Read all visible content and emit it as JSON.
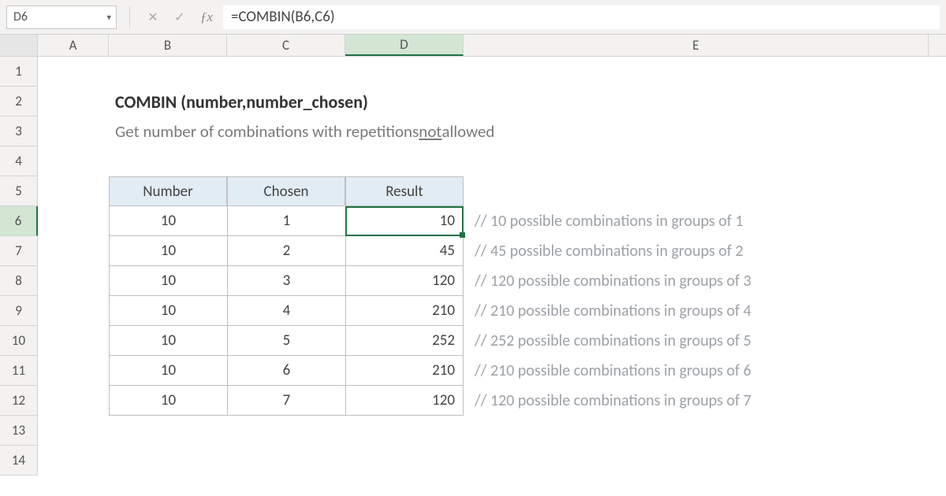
{
  "name_box": "D6",
  "formula": "=COMBIN(B6,C6)",
  "columns": [
    "A",
    "B",
    "C",
    "D",
    "E"
  ],
  "rows": [
    "1",
    "2",
    "3",
    "4",
    "5",
    "6",
    "7",
    "8",
    "9",
    "10",
    "11",
    "12",
    "13",
    "14"
  ],
  "title": "COMBIN (number,number_chosen)",
  "subtitle_pre": "Get number of combinations with repetitions ",
  "subtitle_under": "not",
  "subtitle_post": " allowed",
  "headers": {
    "b": "Number",
    "c": "Chosen",
    "d": "Result"
  },
  "data": [
    {
      "number": "10",
      "chosen": "1",
      "result": "10",
      "comment": "// 10 possible combinations in groups of 1"
    },
    {
      "number": "10",
      "chosen": "2",
      "result": "45",
      "comment": "// 45 possible combinations in groups of 2"
    },
    {
      "number": "10",
      "chosen": "3",
      "result": "120",
      "comment": "// 120 possible combinations in groups of 3"
    },
    {
      "number": "10",
      "chosen": "4",
      "result": "210",
      "comment": "// 210 possible combinations in groups of 4"
    },
    {
      "number": "10",
      "chosen": "5",
      "result": "252",
      "comment": "// 252 possible combinations in groups of 5"
    },
    {
      "number": "10",
      "chosen": "6",
      "result": "210",
      "comment": "// 210 possible combinations in groups of 6"
    },
    {
      "number": "10",
      "chosen": "7",
      "result": "120",
      "comment": "// 120 possible combinations in groups of 7"
    }
  ],
  "selected_cell": "D6",
  "chart_data": {
    "type": "table",
    "title": "COMBIN (number,number_chosen)",
    "columns": [
      "Number",
      "Chosen",
      "Result"
    ],
    "rows": [
      [
        10,
        1,
        10
      ],
      [
        10,
        2,
        45
      ],
      [
        10,
        3,
        120
      ],
      [
        10,
        4,
        210
      ],
      [
        10,
        5,
        252
      ],
      [
        10,
        6,
        210
      ],
      [
        10,
        7,
        120
      ]
    ]
  }
}
